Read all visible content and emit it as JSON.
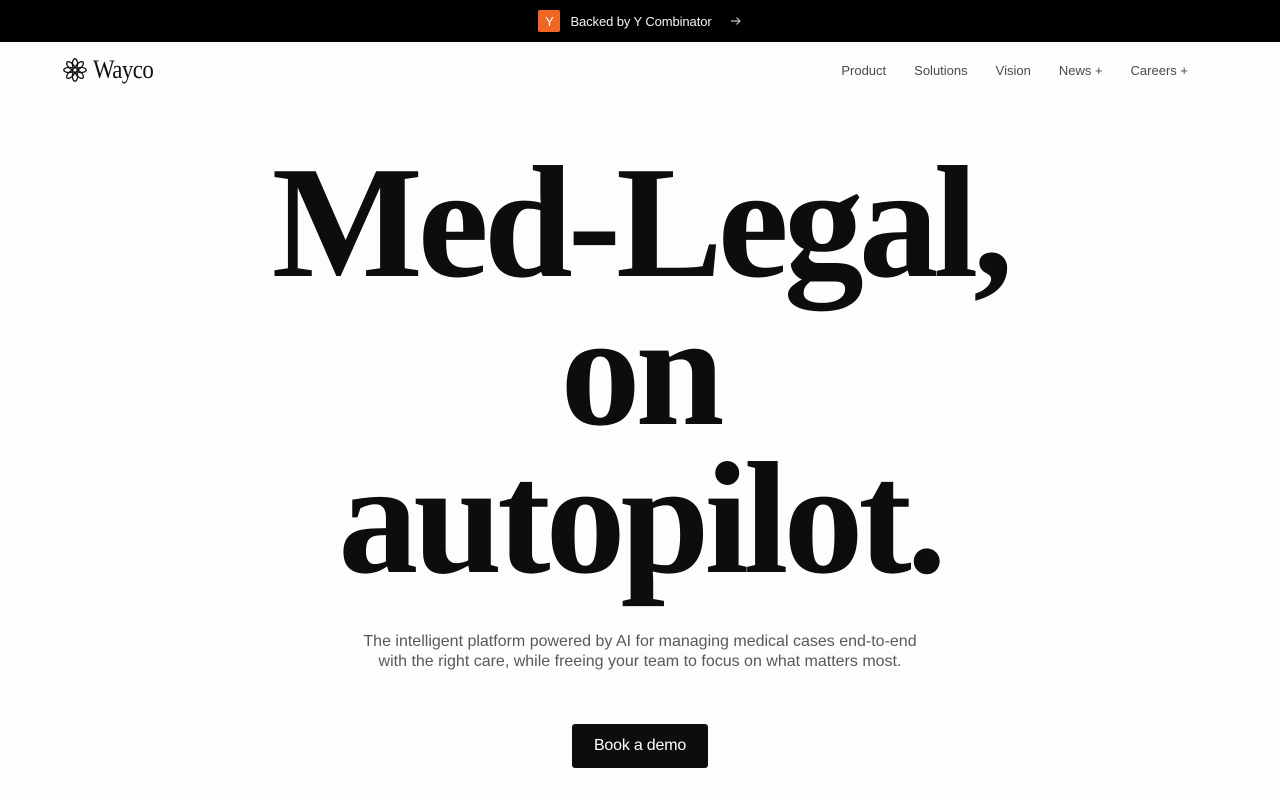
{
  "announcement": {
    "badge_letter": "Y",
    "text": "Backed by Y Combinator",
    "badge_color": "#f26625",
    "arrow_icon": "arrow-right-icon"
  },
  "nav": {
    "brand": "Wayco",
    "brand_icon": "flower-logo-icon",
    "links": [
      "Product",
      "Solutions",
      "Vision",
      "News +",
      "Careers +"
    ]
  },
  "hero": {
    "title_lines": [
      "Med-Legal,",
      "on",
      "autopilot."
    ],
    "subtitle": "The intelligent platform powered by AI for managing medical cases end-to-end with the right care, while freeing your team to focus on what matters most.",
    "cta_label": "Book a demo"
  }
}
